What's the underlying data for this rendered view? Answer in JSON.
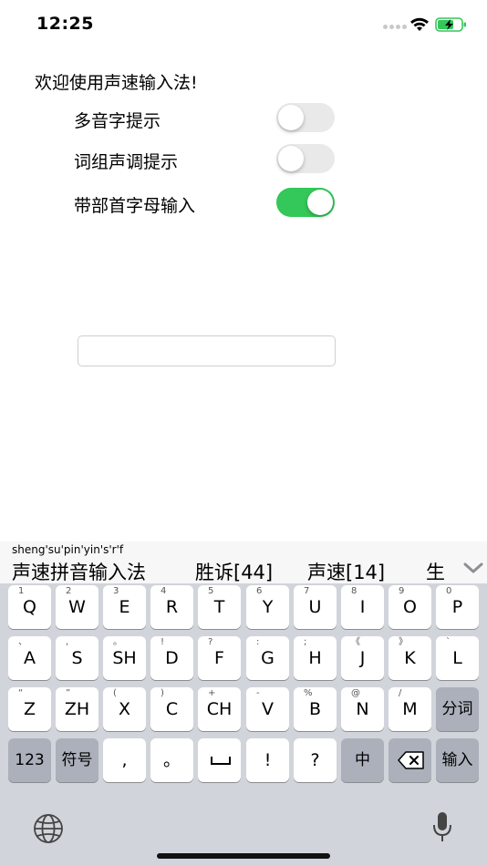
{
  "status": {
    "time": "12:25"
  },
  "settings": {
    "welcome": "欢迎使用声速输入法!",
    "items": [
      {
        "label": "多音字提示",
        "enabled": false
      },
      {
        "label": "词组声调提示",
        "enabled": false
      },
      {
        "label": "带部首字母输入",
        "enabled": true
      }
    ]
  },
  "input": {
    "value": "",
    "placeholder": ""
  },
  "keyboard": {
    "pinyin": "sheng'su'pin'yin's'r'f",
    "candidates": [
      "声速拼音输入法",
      "胜诉[44]",
      "声速[14]",
      "生"
    ],
    "rows": [
      [
        {
          "hint": "1",
          "label": "Q"
        },
        {
          "hint": "2",
          "label": "W"
        },
        {
          "hint": "3",
          "label": "E"
        },
        {
          "hint": "4",
          "label": "R"
        },
        {
          "hint": "5",
          "label": "T"
        },
        {
          "hint": "6",
          "label": "Y"
        },
        {
          "hint": "7",
          "label": "U"
        },
        {
          "hint": "8",
          "label": "I"
        },
        {
          "hint": "9",
          "label": "O"
        },
        {
          "hint": "0",
          "label": "P"
        }
      ],
      [
        {
          "hint": "、",
          "label": "A"
        },
        {
          "hint": ",",
          "label": "S"
        },
        {
          "hint": "。",
          "label": "SH"
        },
        {
          "hint": "!",
          "label": "D"
        },
        {
          "hint": "?",
          "label": "F"
        },
        {
          "hint": ":",
          "label": "G"
        },
        {
          "hint": ";",
          "label": "H"
        },
        {
          "hint": "《",
          "label": "J"
        },
        {
          "hint": "》",
          "label": "K"
        },
        {
          "hint": "`",
          "label": "L"
        }
      ],
      [
        {
          "hint": "“",
          "label": "Z"
        },
        {
          "hint": "”",
          "label": "ZH"
        },
        {
          "hint": "(",
          "label": "X"
        },
        {
          "hint": ")",
          "label": "C"
        },
        {
          "hint": "+",
          "label": "CH"
        },
        {
          "hint": "-",
          "label": "V"
        },
        {
          "hint": "%",
          "label": "B"
        },
        {
          "hint": "@",
          "label": "N"
        },
        {
          "hint": "/",
          "label": "M"
        },
        {
          "hint": "",
          "label": "分词"
        }
      ],
      [
        {
          "hint": "",
          "label": "123"
        },
        {
          "hint": "",
          "label": "符号"
        },
        {
          "hint": "",
          "label": ","
        },
        {
          "hint": "",
          "label": "。"
        },
        {
          "hint": "",
          "label": ""
        },
        {
          "hint": "",
          "label": "!"
        },
        {
          "hint": "",
          "label": "?"
        },
        {
          "hint": "",
          "label": "中"
        },
        {
          "hint": "",
          "label": ""
        },
        {
          "hint": "",
          "label": "输入"
        }
      ]
    ],
    "bottom_icons": [
      "globe-icon",
      "microphone-icon"
    ]
  },
  "colors": {
    "toggle_on": "#34c759",
    "toggle_off": "#e9e9ea",
    "keyboard_bg": "#d1d4da",
    "key_dark": "#abb0bb"
  }
}
